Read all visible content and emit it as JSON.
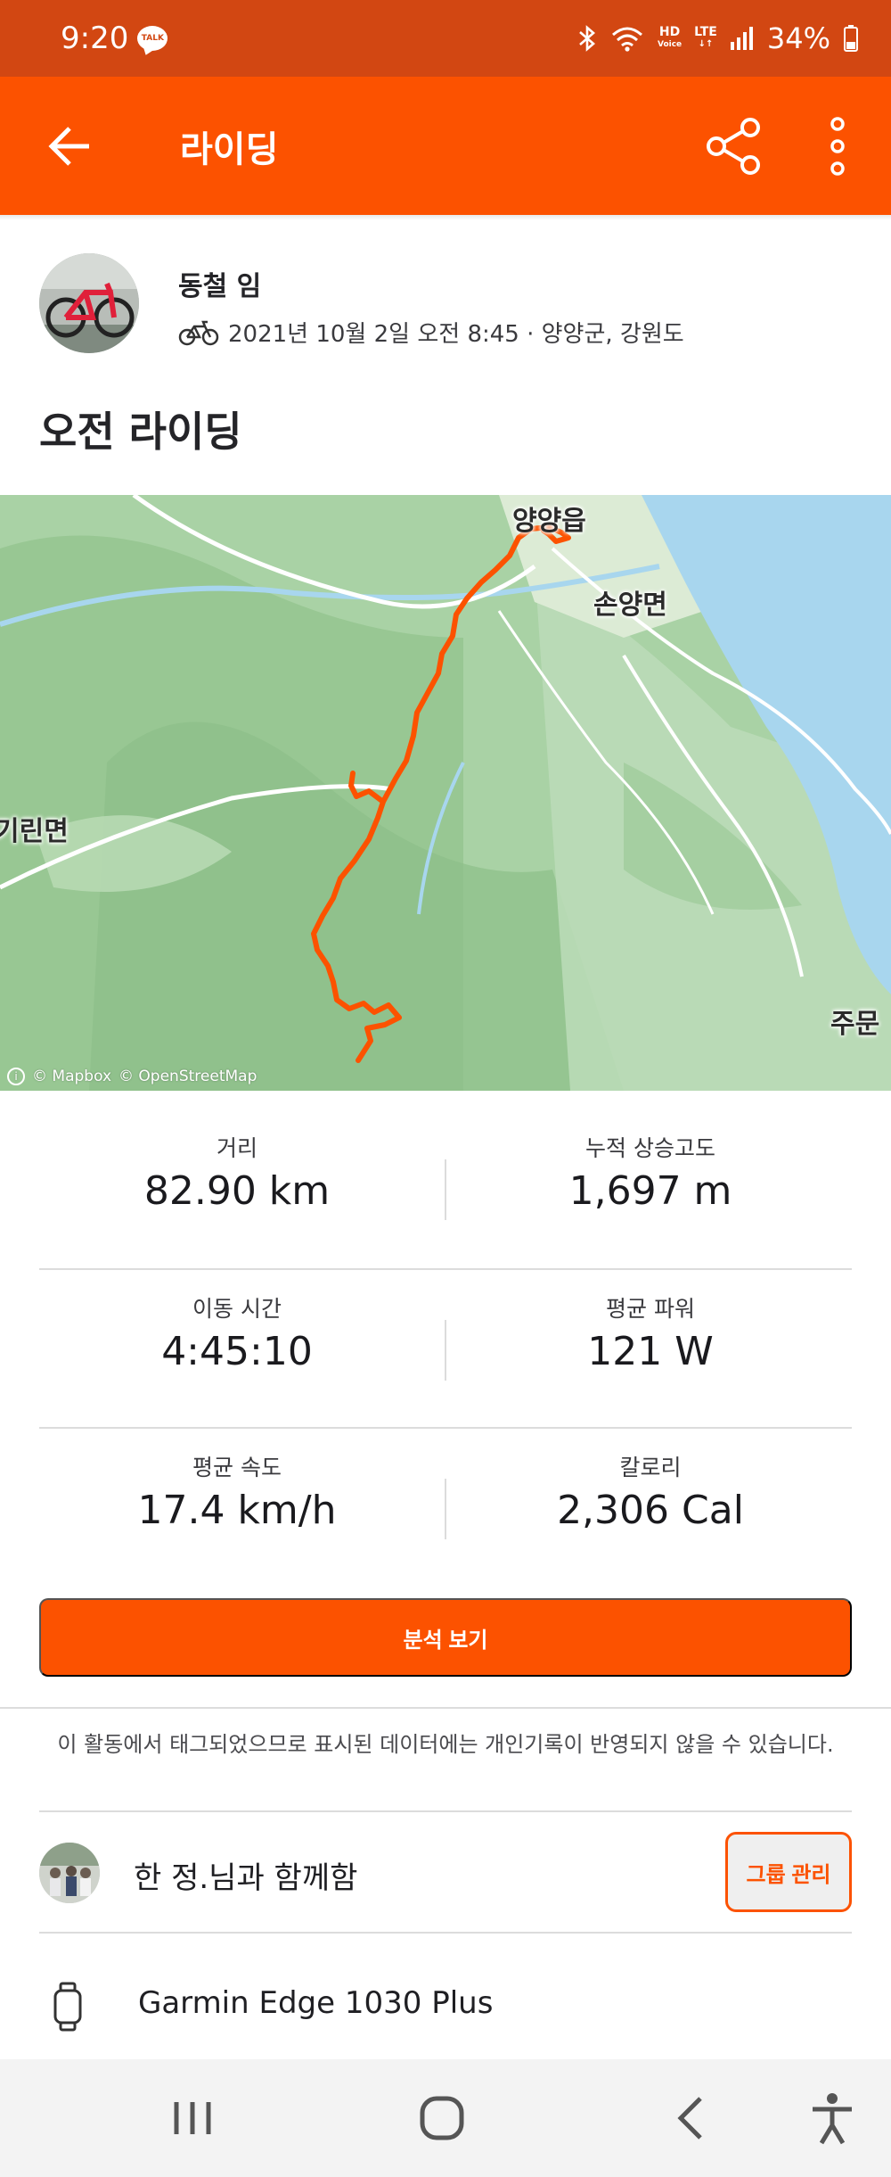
{
  "status_bar": {
    "time": "9:20",
    "talk_badge": "TALK",
    "network_hd": "HD",
    "network_voice": "Voice",
    "network_lte": "LTE",
    "battery": "34%"
  },
  "app_bar": {
    "title": "라이딩"
  },
  "athlete": {
    "name": "동철 임",
    "meta": "2021년 10월 2일 오전 8:45 · 양양군, 강원도"
  },
  "activity": {
    "title": "오전 라이딩"
  },
  "map": {
    "labels": {
      "town_yangyang": "양양읍",
      "town_sonyang": "손양면",
      "town_girin": "기린면",
      "town_jumun": "주문"
    },
    "attribution_mapbox": "© Mapbox",
    "attribution_osm": "© OpenStreetMap",
    "route_color": "#fc5200"
  },
  "stats": [
    {
      "label": "거리",
      "value": "82.90 km"
    },
    {
      "label": "누적 상승고도",
      "value": "1,697 m"
    },
    {
      "label": "이동 시간",
      "value": "4:45:10"
    },
    {
      "label": "평균 파워",
      "value": "121 W"
    },
    {
      "label": "평균 속도",
      "value": "17.4 km/h"
    },
    {
      "label": "칼로리",
      "value": "2,306 Cal"
    }
  ],
  "analysis_button": "분석 보기",
  "notice": "이 활동에서 태그되었으므로 표시된 데이터에는 개인기록이 반영되지 않을 수 있습니다.",
  "group": {
    "text": "한 정.님과 함께함",
    "manage_button": "그룹 관리"
  },
  "device": {
    "name": "Garmin Edge 1030 Plus"
  },
  "colors": {
    "brand": "#fc5200",
    "status_bar": "#d24712"
  }
}
